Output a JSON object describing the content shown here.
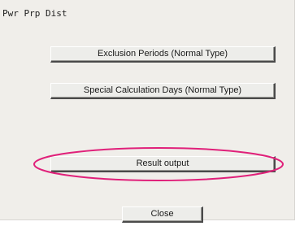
{
  "window": {
    "title": "Pwr Prp Dist"
  },
  "buttons": {
    "exclusion_periods": "Exclusion Periods (Normal Type)",
    "special_calc_days": "Special Calculation Days (Normal Type)",
    "result_output": "Result output",
    "close": "Close"
  },
  "annotation": {
    "highlight_color": "#e0207a",
    "highlighted_item": "result_output"
  }
}
